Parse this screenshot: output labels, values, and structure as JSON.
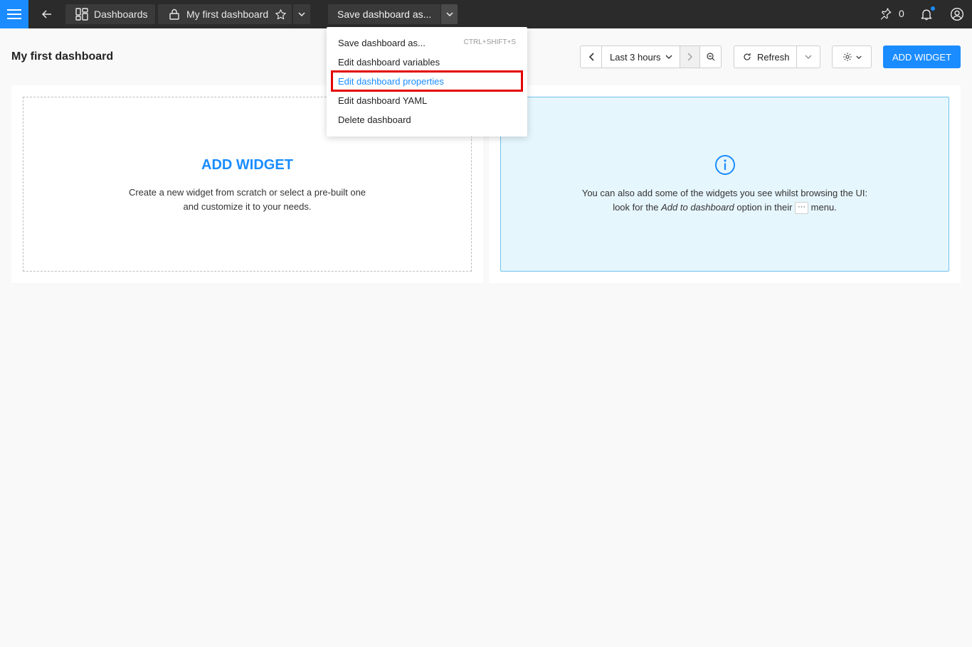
{
  "topbar": {
    "dashboards_label": "Dashboards",
    "current_dashboard": "My first dashboard",
    "save_button": "Save dashboard as...",
    "pin_count": "0"
  },
  "page": {
    "title": "My first dashboard"
  },
  "toolbar": {
    "time_range": "Last 3 hours",
    "refresh_label": "Refresh",
    "add_widget": "ADD WIDGET"
  },
  "add_panel": {
    "title": "ADD WIDGET",
    "line1": "Create a new widget from scratch or select a pre-built one",
    "line2": "and customize it to your needs."
  },
  "info_panel": {
    "line1": "You can also add some of the widgets you see whilst browsing the UI:",
    "line2_prefix": "look for the ",
    "line2_em": "Add to dashboard",
    "line2_mid": " option in their ",
    "line2_kbd": "···",
    "line2_suffix": " menu."
  },
  "menu": {
    "items": [
      {
        "label": "Save dashboard as...",
        "shortcut": "CTRL+SHIFT+S"
      },
      {
        "label": "Edit dashboard variables"
      },
      {
        "label": "Edit dashboard properties"
      },
      {
        "label": "Edit dashboard YAML"
      },
      {
        "label": "Delete dashboard"
      }
    ]
  },
  "colors": {
    "accent": "#1a8cff",
    "topbar": "#2b2b2b",
    "highlight": "#e30000"
  }
}
